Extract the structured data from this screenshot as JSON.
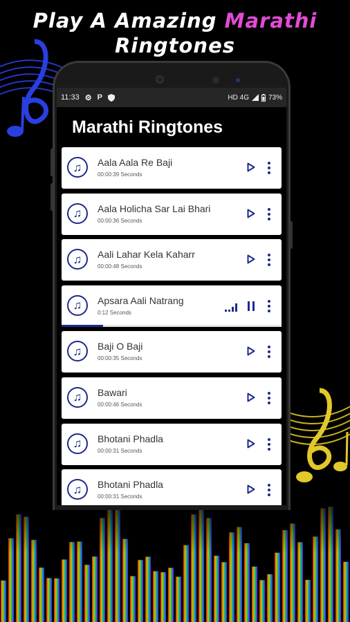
{
  "promo": {
    "line1_prefix": "Play A Amazing ",
    "line1_accent": "Marathi",
    "line2": "Ringtones",
    "accent_color": "#e24bd6"
  },
  "status_bar": {
    "time": "11:33",
    "left_icons": [
      "settings-icon",
      "p-icon",
      "shield-icon"
    ],
    "right_text": "HD 4G",
    "battery": "73%"
  },
  "app": {
    "title": "Marathi Ringtones"
  },
  "ringtones": [
    {
      "title": "Aala Aala Re Baji",
      "duration": "00:00:39 Seconds",
      "state": "idle"
    },
    {
      "title": "Aala Holicha Sar Lai Bhari",
      "duration": "00:00:36 Seconds",
      "state": "idle"
    },
    {
      "title": "Aali Lahar Kela Kaharr",
      "duration": "00:00:48 Seconds",
      "state": "idle"
    },
    {
      "title": "Apsara Aali Natrang",
      "duration": "0:12 Seconds",
      "state": "playing",
      "progress": 0.19
    },
    {
      "title": "Baji O Baji",
      "duration": "00:00:35 Seconds",
      "state": "idle"
    },
    {
      "title": "Bawari",
      "duration": "00:00:46 Seconds",
      "state": "idle"
    },
    {
      "title": "Bhotani Phadla",
      "duration": "00:00:31 Seconds",
      "state": "idle"
    },
    {
      "title": "Bhotani Phadla",
      "duration": "00:00:31 Seconds",
      "state": "idle"
    }
  ],
  "colors": {
    "icon_blue": "#1c2a8a",
    "card_bg": "#ffffff",
    "screen_bg": "#000000"
  }
}
